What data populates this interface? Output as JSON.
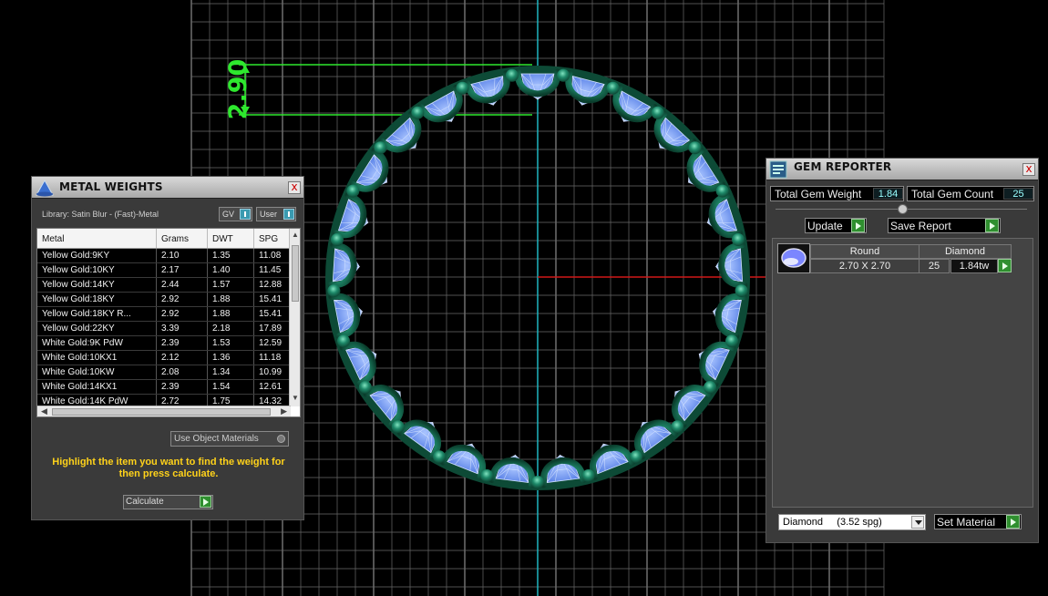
{
  "viewport": {
    "dimension_label": "2.90",
    "colors": {
      "grid": "#6a6a6a",
      "axis_vertical": "#1fb6c0",
      "axis_horizontal": "#d01818",
      "dimension": "#2ee82e",
      "metal": "#1e8a6a",
      "gem": "#7fa7ff"
    }
  },
  "metal_weights": {
    "title": "METAL WEIGHTS",
    "close": "x",
    "library_label": "Library: Satin Blur - (Fast)-Metal",
    "toggle_gv": "GV",
    "toggle_user": "User",
    "columns": [
      "Metal",
      "Grams",
      "DWT",
      "SPG"
    ],
    "rows": [
      [
        "Yellow Gold:9KY",
        "2.10",
        "1.35",
        "11.08"
      ],
      [
        "Yellow Gold:10KY",
        "2.17",
        "1.40",
        "11.45"
      ],
      [
        "Yellow Gold:14KY",
        "2.44",
        "1.57",
        "12.88"
      ],
      [
        "Yellow Gold:18KY",
        "2.92",
        "1.88",
        "15.41"
      ],
      [
        "Yellow Gold:18KY R...",
        "2.92",
        "1.88",
        "15.41"
      ],
      [
        "Yellow Gold:22KY",
        "3.39",
        "2.18",
        "17.89"
      ],
      [
        "White Gold:9K PdW",
        "2.39",
        "1.53",
        "12.59"
      ],
      [
        "White Gold:10KX1",
        "2.12",
        "1.36",
        "11.18"
      ],
      [
        "White Gold:10KW",
        "2.08",
        "1.34",
        "10.99"
      ],
      [
        "White Gold:14KX1",
        "2.39",
        "1.54",
        "12.61"
      ],
      [
        "White Gold:14K PdW",
        "2.72",
        "1.75",
        "14.32"
      ]
    ],
    "use_object_materials": "Use Object Materials",
    "hint": "Highlight the item you want to find the weight for then press calculate.",
    "calculate": "Calculate"
  },
  "gem_reporter": {
    "title": "GEM REPORTER",
    "close": "x",
    "total_weight_label": "Total Gem Weight",
    "total_weight_value": "1.84",
    "total_count_label": "Total Gem Count",
    "total_count_value": "25",
    "update": "Update",
    "save_report": "Save Report",
    "gems": [
      {
        "shape": "Round",
        "material": "Diamond",
        "size": "2.70 X 2.70",
        "count": "25",
        "weight": "1.84tw"
      }
    ],
    "material_select": "Diamond     (3.52 spg)",
    "set_material": "Set Material"
  }
}
